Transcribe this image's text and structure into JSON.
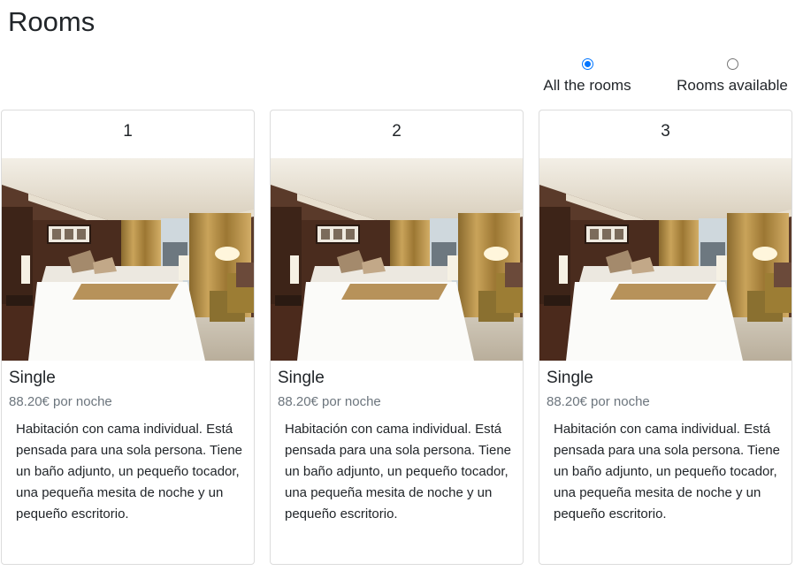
{
  "page": {
    "title": "Rooms"
  },
  "filters": {
    "options": [
      {
        "label": "All the rooms",
        "checked": true
      },
      {
        "label": "Rooms available",
        "checked": false
      }
    ]
  },
  "rooms": [
    {
      "number": "1",
      "type": "Single",
      "price": "88.20€ por noche",
      "description": "Habitación con cama individual. Está pensada para una sola persona. Tiene un baño adjunto, un pequeño tocador, una pequeña mesita de noche y un pequeño escritorio."
    },
    {
      "number": "2",
      "type": "Single",
      "price": "88.20€ por noche",
      "description": "Habitación con cama individual. Está pensada para una sola persona. Tiene un baño adjunto, un pequeño tocador, una pequeña mesita de noche y un pequeño escritorio."
    },
    {
      "number": "3",
      "type": "Single",
      "price": "88.20€ por noche",
      "description": "Habitación con cama individual. Está pensada para una sola persona. Tiene un baño adjunto, un pequeño tocador, una pequeña mesita de noche y un pequeño escritorio."
    }
  ],
  "colors": {
    "accent": "#0075ff",
    "muted": "#6c757d",
    "border": "#dcdcdc"
  }
}
